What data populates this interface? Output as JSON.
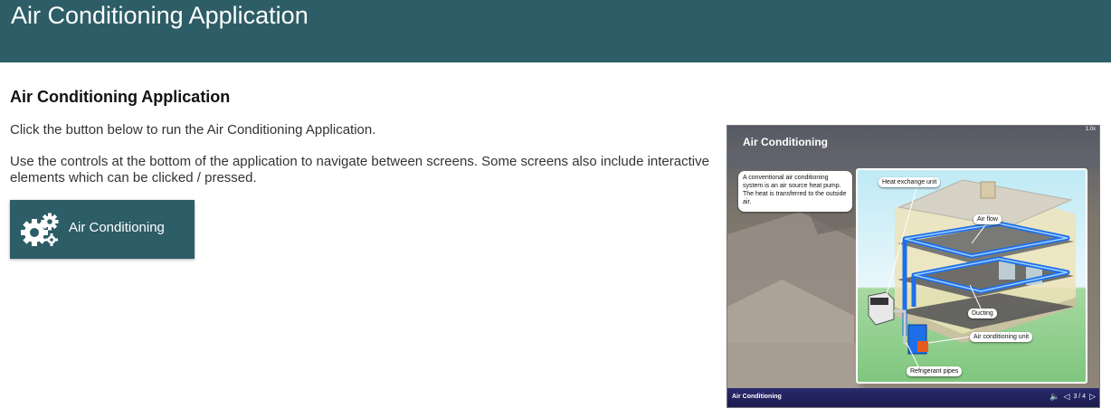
{
  "banner": {
    "title": "Air Conditioning Application"
  },
  "content": {
    "heading": "Air Conditioning Application",
    "paragraph1": "Click the button below to run the Air Conditioning Application.",
    "paragraph2": "Use the controls at the bottom of the application to navigate between screens. Some screens also include interactive elements which can be clicked / pressed.",
    "button_label": "Air Conditioning",
    "button_icon": "gears-icon"
  },
  "preview": {
    "title": "Air Conditioning",
    "zoom": "1.0x",
    "info_text": "A conventional air conditioning system is an air source heat pump. The heat is transferred to the outside air.",
    "labels": {
      "heat_exchange": "Heat exchange unit",
      "air_flow": "Air flow",
      "ducting": "Ducting",
      "ac_unit": "Air conditioning unit",
      "pipes": "Refrigerant pipes"
    },
    "bar_title": "Air Conditioning",
    "page_indicator": "3 / 4"
  },
  "colors": {
    "brand": "#2d5d66",
    "ducting": "#1e6fe8",
    "bar": "#22225e"
  }
}
